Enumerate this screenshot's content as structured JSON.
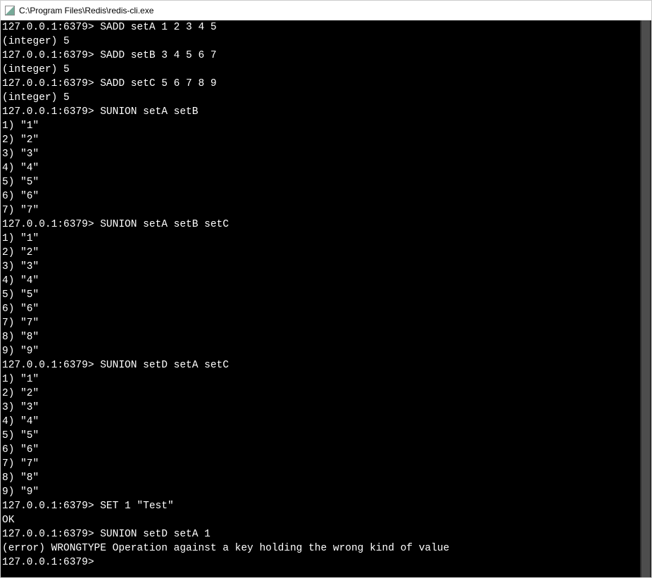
{
  "window": {
    "title": "C:\\Program Files\\Redis\\redis-cli.exe"
  },
  "prompt": "127.0.0.1:6379>",
  "lines": [
    {
      "prompt": true,
      "text": "SADD setA 1 2 3 4 5"
    },
    {
      "prompt": false,
      "text": "(integer) 5"
    },
    {
      "prompt": true,
      "text": "SADD setB 3 4 5 6 7"
    },
    {
      "prompt": false,
      "text": "(integer) 5"
    },
    {
      "prompt": true,
      "text": "SADD setC 5 6 7 8 9"
    },
    {
      "prompt": false,
      "text": "(integer) 5"
    },
    {
      "prompt": true,
      "text": "SUNION setA setB"
    },
    {
      "prompt": false,
      "text": "1) \"1\""
    },
    {
      "prompt": false,
      "text": "2) \"2\""
    },
    {
      "prompt": false,
      "text": "3) \"3\""
    },
    {
      "prompt": false,
      "text": "4) \"4\""
    },
    {
      "prompt": false,
      "text": "5) \"5\""
    },
    {
      "prompt": false,
      "text": "6) \"6\""
    },
    {
      "prompt": false,
      "text": "7) \"7\""
    },
    {
      "prompt": true,
      "text": "SUNION setA setB setC"
    },
    {
      "prompt": false,
      "text": "1) \"1\""
    },
    {
      "prompt": false,
      "text": "2) \"2\""
    },
    {
      "prompt": false,
      "text": "3) \"3\""
    },
    {
      "prompt": false,
      "text": "4) \"4\""
    },
    {
      "prompt": false,
      "text": "5) \"5\""
    },
    {
      "prompt": false,
      "text": "6) \"6\""
    },
    {
      "prompt": false,
      "text": "7) \"7\""
    },
    {
      "prompt": false,
      "text": "8) \"8\""
    },
    {
      "prompt": false,
      "text": "9) \"9\""
    },
    {
      "prompt": true,
      "text": "SUNION setD setA setC"
    },
    {
      "prompt": false,
      "text": "1) \"1\""
    },
    {
      "prompt": false,
      "text": "2) \"2\""
    },
    {
      "prompt": false,
      "text": "3) \"3\""
    },
    {
      "prompt": false,
      "text": "4) \"4\""
    },
    {
      "prompt": false,
      "text": "5) \"5\""
    },
    {
      "prompt": false,
      "text": "6) \"6\""
    },
    {
      "prompt": false,
      "text": "7) \"7\""
    },
    {
      "prompt": false,
      "text": "8) \"8\""
    },
    {
      "prompt": false,
      "text": "9) \"9\""
    },
    {
      "prompt": true,
      "text": "SET 1 \"Test\""
    },
    {
      "prompt": false,
      "text": "OK"
    },
    {
      "prompt": true,
      "text": "SUNION setD setA 1"
    },
    {
      "prompt": false,
      "text": "(error) WRONGTYPE Operation against a key holding the wrong kind of value"
    },
    {
      "prompt": true,
      "text": ""
    }
  ]
}
